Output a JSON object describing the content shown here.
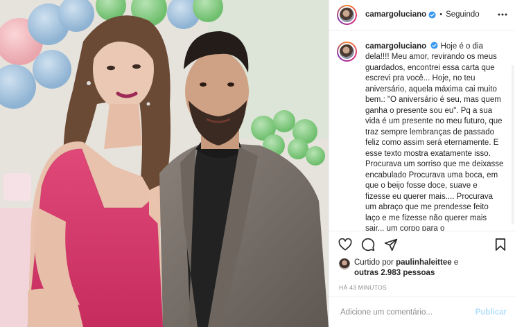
{
  "header": {
    "username": "camargoluciano",
    "separator": "•",
    "follow_status": "Seguindo"
  },
  "caption": {
    "username": "camargoluciano",
    "text": "Hoje é o dia dela!!!! Meu amor, revirando os meus guardados, encontrei essa carta que escrevi pra você... Hoje, no teu aniversário, aquela máxima cai muito bem.: \"O aniversário é seu, mas quem ganha o presente sou eu\". Pq a sua vida é um presente no meu futuro, que traz sempre lembranças de passado feliz como assim será eternamente. E esse texto mostra exatamente isso. Procurava um sorriso que me deixasse encabulado Procurava uma boca, em que o beijo fosse doce, suave e fizesse eu querer mais.... Procurava um abraço que me prendesse feito laço e me fizesse não querer mais sair... um corpo para o"
  },
  "likes": {
    "prefix": "Curtido por ",
    "user": "paulinhaleittee",
    "connector": " e ",
    "others": "outras 2.983 pessoas"
  },
  "timestamp": "HÁ 43 MINUTOS",
  "comment": {
    "placeholder": "Adicione um comentário...",
    "publish_label": "Publicar"
  },
  "icons": {
    "more": "more-options-icon",
    "like": "heart-icon",
    "comment": "comment-icon",
    "share": "share-icon",
    "save": "bookmark-icon",
    "verified": "verified-badge-icon"
  },
  "colors": {
    "verified": "#3897f0",
    "publish_disabled": "#b2dffc",
    "muted": "#8e8e8e",
    "dress": "#d8376b"
  }
}
